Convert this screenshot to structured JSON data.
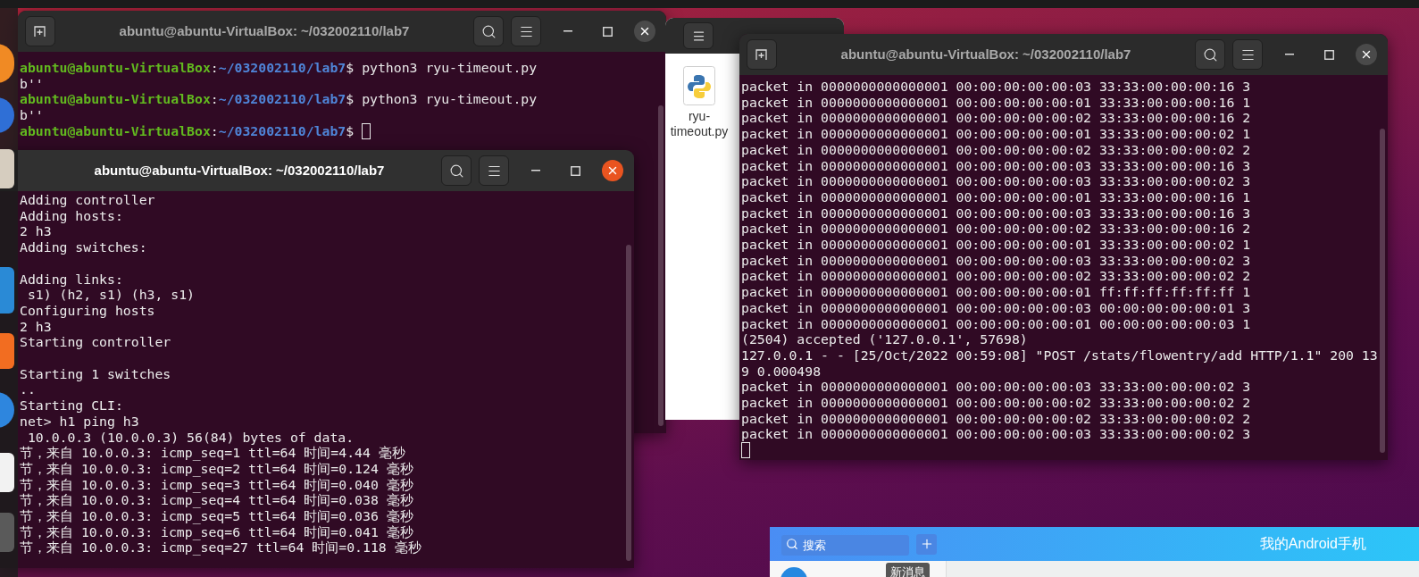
{
  "windows": [
    {
      "kind": "terminal",
      "title": "abuntu@abuntu-VirtualBox: ~/032002110/lab7",
      "focused": false,
      "lines": [
        {
          "kind": "prompt",
          "user": "abuntu@abuntu-VirtualBox",
          "separator": ":",
          "path": "~/032002110/lab7",
          "symbol": "$",
          "command": "python3 ryu-timeout.py",
          "cursor": false
        },
        {
          "kind": "output",
          "text": "b''"
        },
        {
          "kind": "prompt",
          "user": "abuntu@abuntu-VirtualBox",
          "separator": ":",
          "path": "~/032002110/lab7",
          "symbol": "$",
          "command": "python3 ryu-timeout.py",
          "cursor": false
        },
        {
          "kind": "output",
          "text": "b''"
        },
        {
          "kind": "prompt",
          "user": "abuntu@abuntu-VirtualBox",
          "separator": ":",
          "path": "~/032002110/lab7",
          "symbol": "$",
          "cursor": true
        }
      ]
    },
    {
      "kind": "files",
      "items": [
        {
          "name": "ryu-timeout.py"
        }
      ]
    },
    {
      "kind": "terminal",
      "title": "abuntu@abuntu-VirtualBox: ~/032002110/lab7",
      "focused": true,
      "lines": [
        {
          "kind": "output",
          "text": "Adding controller"
        },
        {
          "kind": "output",
          "text": "Adding hosts:"
        },
        {
          "kind": "output",
          "text": "2 h3"
        },
        {
          "kind": "output",
          "text": "Adding switches:"
        },
        {
          "kind": "blank"
        },
        {
          "kind": "output",
          "text": "Adding links:"
        },
        {
          "kind": "output",
          "text": " s1) (h2, s1) (h3, s1)"
        },
        {
          "kind": "output",
          "text": "Configuring hosts"
        },
        {
          "kind": "output",
          "text": "2 h3"
        },
        {
          "kind": "output",
          "text": "Starting controller"
        },
        {
          "kind": "blank"
        },
        {
          "kind": "output",
          "text": "Starting 1 switches"
        },
        {
          "kind": "output",
          "text": ".."
        },
        {
          "kind": "output",
          "text": "Starting CLI:"
        },
        {
          "kind": "output",
          "text": "net> h1 ping h3"
        },
        {
          "kind": "output",
          "text": " 10.0.0.3 (10.0.0.3) 56(84) bytes of data."
        },
        {
          "kind": "output",
          "text": "节，来自 10.0.0.3: icmp_seq=1 ttl=64 时间=4.44 毫秒"
        },
        {
          "kind": "output",
          "text": "节，来自 10.0.0.3: icmp_seq=2 ttl=64 时间=0.124 毫秒"
        },
        {
          "kind": "output",
          "text": "节，来自 10.0.0.3: icmp_seq=3 ttl=64 时间=0.040 毫秒"
        },
        {
          "kind": "output",
          "text": "节，来自 10.0.0.3: icmp_seq=4 ttl=64 时间=0.038 毫秒"
        },
        {
          "kind": "output",
          "text": "节，来自 10.0.0.3: icmp_seq=5 ttl=64 时间=0.036 毫秒"
        },
        {
          "kind": "output",
          "text": "节，来自 10.0.0.3: icmp_seq=6 ttl=64 时间=0.041 毫秒"
        },
        {
          "kind": "output",
          "text": "节，来自 10.0.0.3: icmp_seq=27 ttl=64 时间=0.118 毫秒"
        }
      ]
    },
    {
      "kind": "terminal",
      "title": "abuntu@abuntu-VirtualBox: ~/032002110/lab7",
      "focused": false,
      "lines": [
        {
          "kind": "output",
          "text": "packet in 0000000000000001 00:00:00:00:00:03 33:33:00:00:00:16 3"
        },
        {
          "kind": "output",
          "text": "packet in 0000000000000001 00:00:00:00:00:01 33:33:00:00:00:16 1"
        },
        {
          "kind": "output",
          "text": "packet in 0000000000000001 00:00:00:00:00:02 33:33:00:00:00:16 2"
        },
        {
          "kind": "output",
          "text": "packet in 0000000000000001 00:00:00:00:00:01 33:33:00:00:00:02 1"
        },
        {
          "kind": "output",
          "text": "packet in 0000000000000001 00:00:00:00:00:02 33:33:00:00:00:02 2"
        },
        {
          "kind": "output",
          "text": "packet in 0000000000000001 00:00:00:00:00:03 33:33:00:00:00:16 3"
        },
        {
          "kind": "output",
          "text": "packet in 0000000000000001 00:00:00:00:00:03 33:33:00:00:00:02 3"
        },
        {
          "kind": "output",
          "text": "packet in 0000000000000001 00:00:00:00:00:01 33:33:00:00:00:16 1"
        },
        {
          "kind": "output",
          "text": "packet in 0000000000000001 00:00:00:00:00:03 33:33:00:00:00:16 3"
        },
        {
          "kind": "output",
          "text": "packet in 0000000000000001 00:00:00:00:00:02 33:33:00:00:00:16 2"
        },
        {
          "kind": "output",
          "text": "packet in 0000000000000001 00:00:00:00:00:01 33:33:00:00:00:02 1"
        },
        {
          "kind": "output",
          "text": "packet in 0000000000000001 00:00:00:00:00:03 33:33:00:00:00:02 3"
        },
        {
          "kind": "output",
          "text": "packet in 0000000000000001 00:00:00:00:00:02 33:33:00:00:00:02 2"
        },
        {
          "kind": "output",
          "text": "packet in 0000000000000001 00:00:00:00:00:01 ff:ff:ff:ff:ff:ff 1"
        },
        {
          "kind": "output",
          "text": "packet in 0000000000000001 00:00:00:00:00:03 00:00:00:00:00:01 3"
        },
        {
          "kind": "output",
          "text": "packet in 0000000000000001 00:00:00:00:00:01 00:00:00:00:00:03 1"
        },
        {
          "kind": "output",
          "text": "(2504) accepted ('127.0.0.1', 57698)"
        },
        {
          "kind": "output",
          "text": "127.0.0.1 - - [25/Oct/2022 00:59:08] \"POST /stats/flowentry/add HTTP/1.1\" 200 13"
        },
        {
          "kind": "output",
          "text": "9 0.000498"
        },
        {
          "kind": "output",
          "text": "packet in 0000000000000001 00:00:00:00:00:03 33:33:00:00:00:02 3"
        },
        {
          "kind": "output",
          "text": "packet in 0000000000000001 00:00:00:00:00:02 33:33:00:00:00:02 2"
        },
        {
          "kind": "output",
          "text": "packet in 0000000000000001 00:00:00:00:00:02 33:33:00:00:00:02 2"
        },
        {
          "kind": "output",
          "text": "packet in 0000000000000001 00:00:00:00:00:03 33:33:00:00:00:02 3"
        },
        {
          "kind": "cursor"
        }
      ]
    },
    {
      "kind": "phone_app",
      "search": {
        "placeholder": "搜索"
      },
      "title": "我的Android手机",
      "tooltip": "新消息"
    }
  ]
}
